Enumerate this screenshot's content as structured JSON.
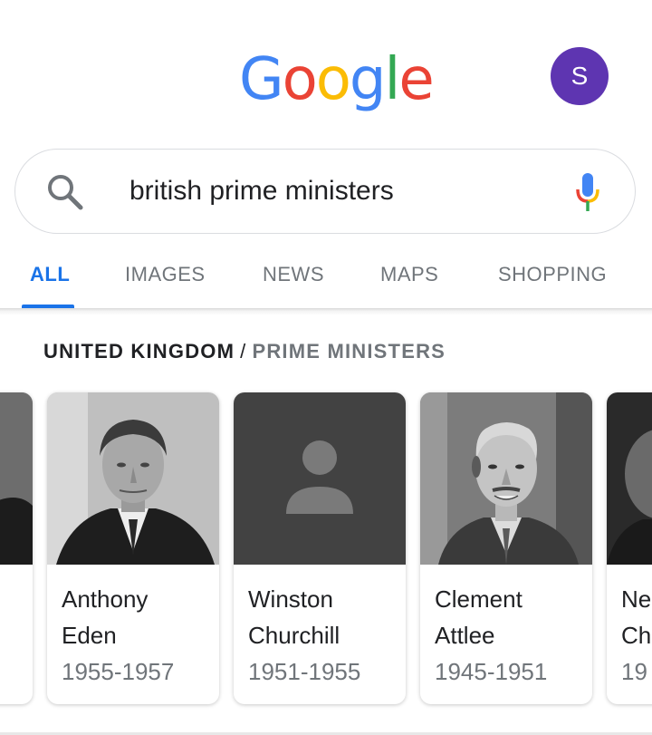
{
  "header": {
    "logo_letters": [
      "G",
      "o",
      "o",
      "g",
      "l",
      "e"
    ],
    "avatar_initial": "S"
  },
  "search": {
    "query": "british prime ministers"
  },
  "tabs": [
    {
      "label": "ALL",
      "active": true
    },
    {
      "label": "IMAGES",
      "active": false
    },
    {
      "label": "NEWS",
      "active": false
    },
    {
      "label": "MAPS",
      "active": false
    },
    {
      "label": "SHOPPING",
      "active": false
    }
  ],
  "breadcrumb": {
    "primary": "UNITED KINGDOM",
    "separator": "/",
    "secondary": "PRIME MINISTERS"
  },
  "carousel": [
    {
      "name_line1": "",
      "name_line2": "",
      "years": "",
      "photo": "portrait"
    },
    {
      "name_line1": "Anthony",
      "name_line2": "Eden",
      "years": "1955-1957",
      "photo": "portrait"
    },
    {
      "name_line1": "Winston",
      "name_line2": "Churchill",
      "years": "1951-1955",
      "photo": "placeholder-person-icon"
    },
    {
      "name_line1": "Clement",
      "name_line2": "Attlee",
      "years": "1945-1951",
      "photo": "portrait"
    },
    {
      "name_line1": "Ne",
      "name_line2": "Ch",
      "years": "19",
      "photo": "portrait"
    }
  ],
  "colors": {
    "blue": "#4285f4",
    "red": "#ea4335",
    "yellow": "#fbbc05",
    "green": "#34a853",
    "active_tab": "#1a73e8",
    "avatar": "#5e35b1",
    "placeholder_bg": "#424242"
  }
}
